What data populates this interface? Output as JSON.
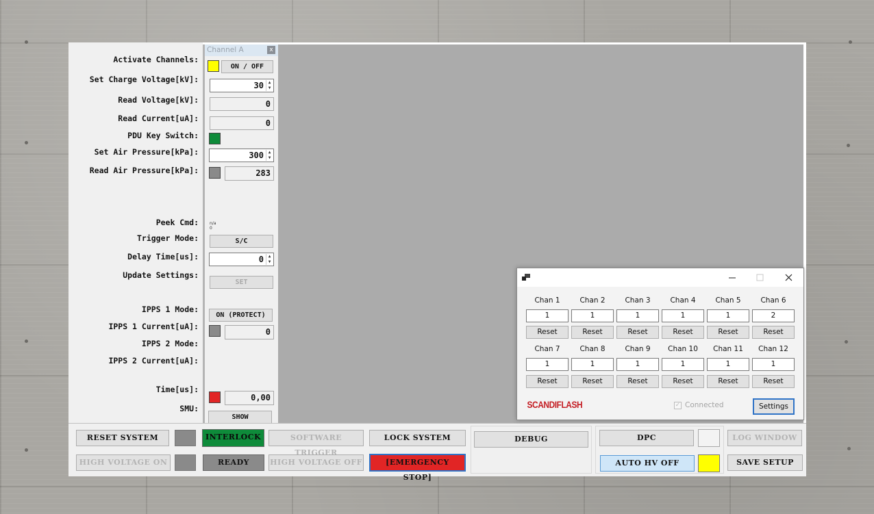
{
  "colors": {
    "yellow": "#ffff00",
    "green": "#0e8b3a",
    "red": "#e12525",
    "gray": "#8a8a8a",
    "blue_light": "#cfe6f8"
  },
  "labels": {
    "activate_channels": "Activate Channels:",
    "set_charge_voltage": "Set Charge Voltage[kV]:",
    "read_voltage": "Read Voltage[kV]:",
    "read_current": "Read Current[uA]:",
    "pdu_key_switch": "PDU Key Switch:",
    "set_air_pressure": "Set Air Pressure[kPa]:",
    "read_air_pressure": "Read Air Pressure[kPa]:",
    "peek_cmd": "Peek Cmd:",
    "trigger_mode": "Trigger Mode:",
    "delay_time": "Delay Time[us]:",
    "update_settings": "Update Settings:",
    "ipps1_mode": "IPPS 1 Mode:",
    "ipps1_current": "IPPS 1 Current[uA]:",
    "ipps2_mode": "IPPS 2 Mode:",
    "ipps2_current": "IPPS 2 Current[uA]:",
    "time_us": "Time[us]:",
    "smu": "SMU:"
  },
  "channel_a": {
    "title": "Channel A",
    "close": "x",
    "on_off": "ON / OFF",
    "set_charge_voltage": "30",
    "read_voltage": "0",
    "read_current": "0",
    "set_air_pressure": "300",
    "read_air_pressure": "283",
    "peek_na": "n/a",
    "peek_zero": "0",
    "trigger_mode": "S/C",
    "delay_time": "0",
    "set": "SET",
    "ipps1_mode": "ON (PROTECT)",
    "ipps1_current": "0",
    "time_value": "0,00",
    "show": "SHOW"
  },
  "bottom": {
    "reset_system": "RESET SYSTEM",
    "interlock": "INTERLOCK",
    "software_trigger": "SOFTWARE TRIGGER",
    "lock_system": "LOCK SYSTEM",
    "debug": "DEBUG",
    "dpc": "DPC",
    "log_window": "LOG WINDOW",
    "high_voltage_on": "HIGH VOLTAGE ON",
    "ready": "READY",
    "high_voltage_off": "HIGH VOLTAGE OFF",
    "emergency_stop": "[EMERGENCY STOP]",
    "auto_hv_off": "AUTO HV OFF",
    "save_setup": "SAVE SETUP"
  },
  "dialog": {
    "channels_row1": [
      {
        "label": "Chan 1",
        "value": "1",
        "reset": "Reset"
      },
      {
        "label": "Chan 2",
        "value": "1",
        "reset": "Reset"
      },
      {
        "label": "Chan 3",
        "value": "1",
        "reset": "Reset"
      },
      {
        "label": "Chan 4",
        "value": "1",
        "reset": "Reset"
      },
      {
        "label": "Chan 5",
        "value": "1",
        "reset": "Reset"
      },
      {
        "label": "Chan 6",
        "value": "2",
        "reset": "Reset"
      }
    ],
    "channels_row2": [
      {
        "label": "Chan 7",
        "value": "1",
        "reset": "Reset"
      },
      {
        "label": "Chan 8",
        "value": "1",
        "reset": "Reset"
      },
      {
        "label": "Chan 9",
        "value": "1",
        "reset": "Reset"
      },
      {
        "label": "Chan 10",
        "value": "1",
        "reset": "Reset"
      },
      {
        "label": "Chan 11",
        "value": "1",
        "reset": "Reset"
      },
      {
        "label": "Chan 12",
        "value": "1",
        "reset": "Reset"
      }
    ],
    "logo_text": "SCANDIFLASH",
    "connected": "Connected",
    "settings": "Settings"
  }
}
